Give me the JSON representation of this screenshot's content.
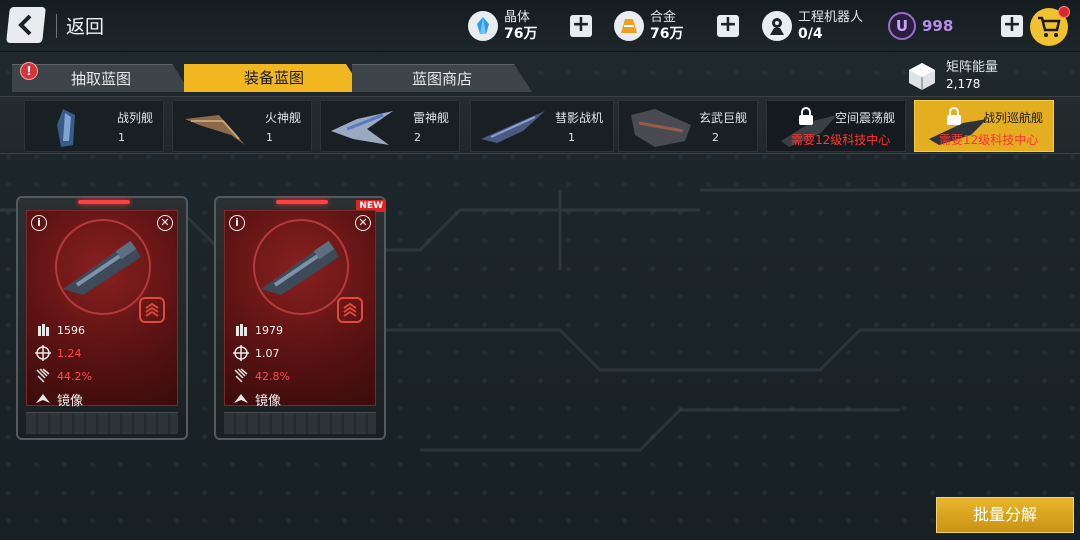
{
  "topbar": {
    "back_label": "返回",
    "resources": [
      {
        "name": "晶体",
        "value": "76万",
        "icon": "crystal-icon"
      },
      {
        "name": "合金",
        "value": "76万",
        "icon": "alloy-icon"
      },
      {
        "name": "工程机器人",
        "value": "0/4",
        "icon": "robot-icon"
      }
    ],
    "premium": {
      "symbol": "U",
      "value": "998"
    },
    "colors": {
      "accent": "#f2b620",
      "premium": "#b98cf0",
      "warning": "#ff3434"
    }
  },
  "tabs": [
    {
      "label": "抽取蓝图",
      "active": false,
      "alert": "!"
    },
    {
      "label": "装备蓝图",
      "active": true
    },
    {
      "label": "蓝图商店",
      "active": false
    }
  ],
  "matrix": {
    "name": "矩阵能量",
    "value": "2,178"
  },
  "ships": [
    {
      "name": "战列舰",
      "count": "1"
    },
    {
      "name": "火神舰",
      "count": "1"
    },
    {
      "name": "雷神舰",
      "count": "2"
    },
    {
      "name": "彗影战机",
      "count": "1"
    },
    {
      "name": "玄武巨舰",
      "count": "2"
    },
    {
      "name": "空间震荡舰",
      "requirement": "需要12级科技中心",
      "locked": true
    },
    {
      "name": "战列巡航舰",
      "requirement": "需要12级科技中心",
      "locked": true,
      "selected": true
    }
  ],
  "cards": [
    {
      "info": "i",
      "ammo": "1596",
      "accuracy": "1.24",
      "damage": "44.2%",
      "mode": "镜像",
      "is_new": false
    },
    {
      "info": "i",
      "ammo": "1979",
      "accuracy": "1.07",
      "damage": "42.8%",
      "mode": "镜像",
      "is_new": true,
      "new_label": "NEW"
    }
  ],
  "actions": {
    "bulk_label": "批量分解"
  }
}
